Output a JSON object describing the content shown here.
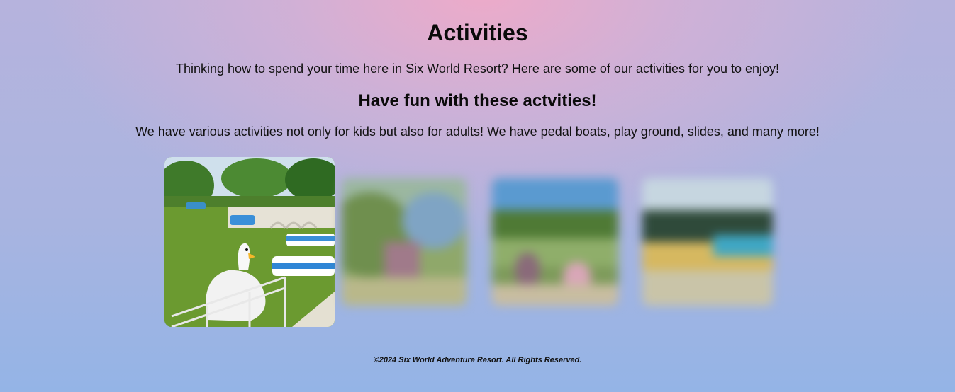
{
  "page": {
    "title": "Activities",
    "intro": "Thinking how to spend your time here in Six World Resort? Here are some of our activities for you to enjoy!",
    "subtitle": "Have fun with these actvities!",
    "description": "We have various activities not only for kids but also for adults! We have pedal boats, play ground, slides, and many more!"
  },
  "gallery": {
    "images": [
      {
        "name": "swan-pedal-boat-photo",
        "state": "focused"
      },
      {
        "name": "playground-photo",
        "state": "blurred"
      },
      {
        "name": "park-visitors-photo",
        "state": "blurred"
      },
      {
        "name": "slides-photo",
        "state": "blurred"
      }
    ]
  },
  "footer": {
    "copyright": "©2024 Six World Adventure Resort. All Rights Reserved."
  },
  "colors": {
    "background_top": "#e9a9cc",
    "background_bottom": "#94b4e6",
    "divider": "#e9ecf3"
  }
}
